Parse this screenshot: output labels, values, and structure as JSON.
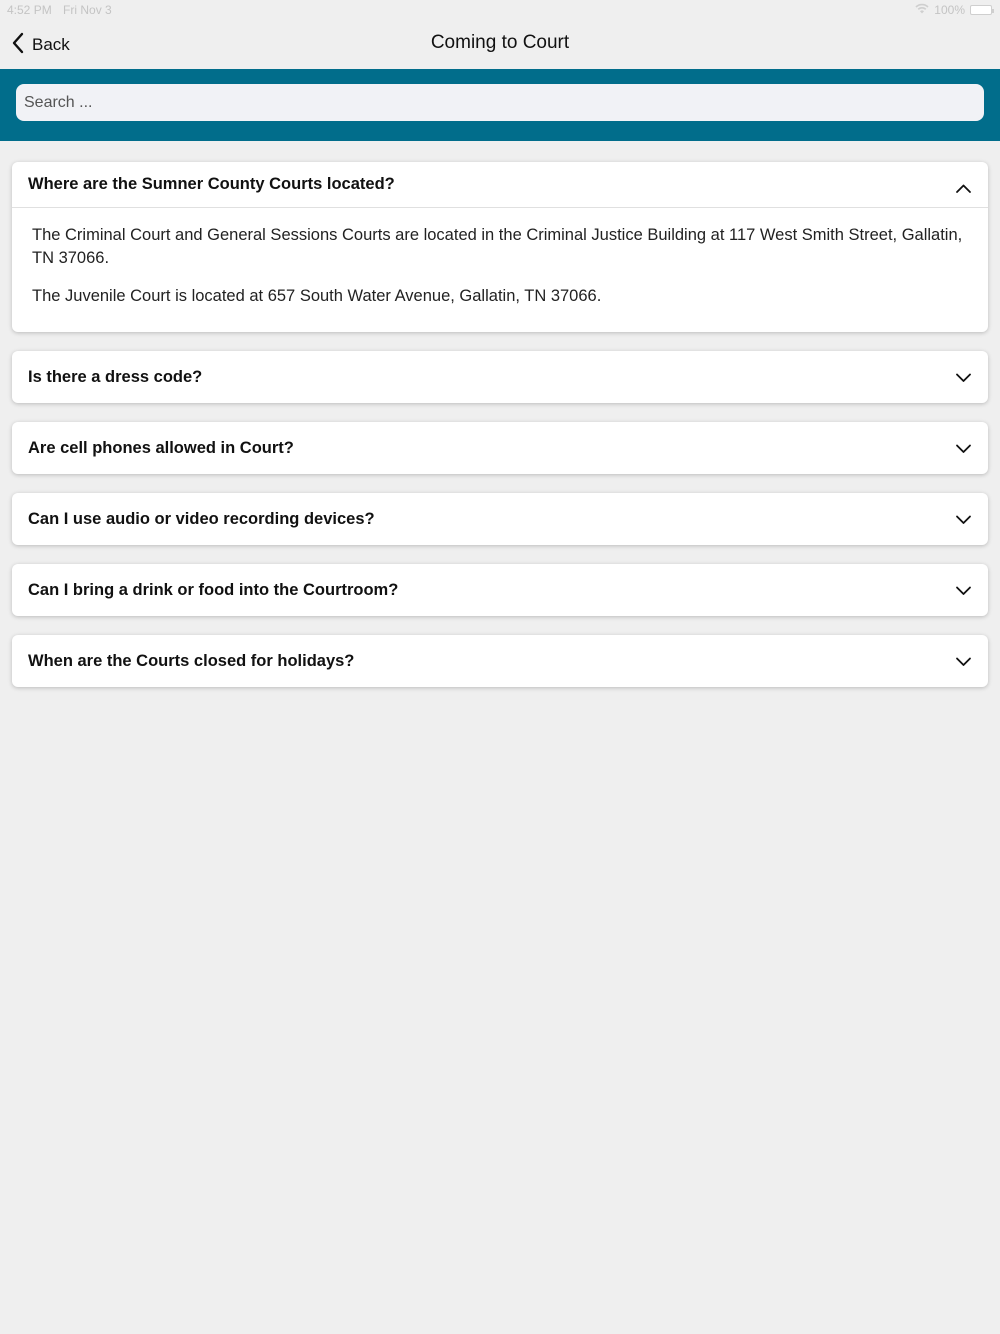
{
  "status_bar": {
    "time": "4:52 PM",
    "date": "Fri Nov 3",
    "battery": "100%"
  },
  "nav": {
    "back_label": "Back",
    "title": "Coming to Court"
  },
  "search": {
    "placeholder": "Search ..."
  },
  "colors": {
    "accent_band": "#016d8b",
    "background": "#efefef"
  },
  "faq": {
    "items": [
      {
        "question": "Where are the Sumner County Courts located?",
        "expanded": true,
        "answer": [
          "The Criminal Court and General Sessions Courts are located in the Criminal Justice Building at 117 West Smith Street, Gallatin, TN 37066.",
          "The Juvenile Court is located at 657 South Water Avenue, Gallatin, TN 37066."
        ]
      },
      {
        "question": "Is there a dress code?",
        "expanded": false
      },
      {
        "question": "Are cell phones allowed in Court?",
        "expanded": false
      },
      {
        "question": "Can I use audio or video recording devices?",
        "expanded": false
      },
      {
        "question": "Can I bring a drink or food into the Courtroom?",
        "expanded": false
      },
      {
        "question": "When are the Courts closed for holidays?",
        "expanded": false
      }
    ]
  }
}
